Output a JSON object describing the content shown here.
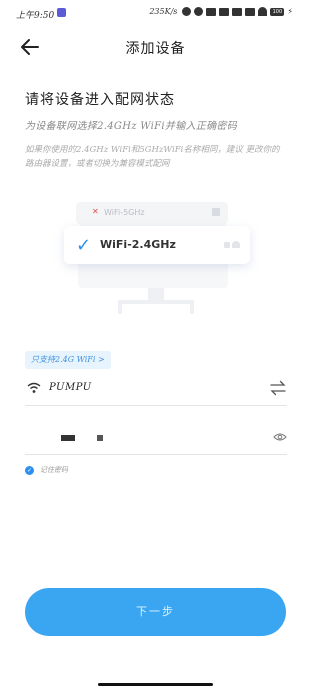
{
  "status_bar": {
    "time": "上午9:50",
    "net_speed": "235K/s",
    "battery": "100"
  },
  "header": {
    "title": "添加设备"
  },
  "main": {
    "heading": "请将设备进入配网状态",
    "subheading": "为设备联网选择2.4GHz WiFi并输入正确密码",
    "note": "如果你使用的2.4GHz WiFi和5GHzWiFi名称相同，建议 更改你的路由器设置，或者切换为兼容模式配网",
    "illustration": {
      "band_5g_label": "WiFi-5GHz",
      "band_24g_label": "WiFi-2.4GHz"
    },
    "support_tag": "只支持2.4G WiFi >",
    "ssid": "PUMPU",
    "remember_label": "记住密码",
    "next_button": "下一步"
  },
  "colors": {
    "accent": "#3aa6f2",
    "check": "#2d8ff0",
    "tag_bg": "#e8f4fd",
    "error_x": "#e84a4a"
  }
}
